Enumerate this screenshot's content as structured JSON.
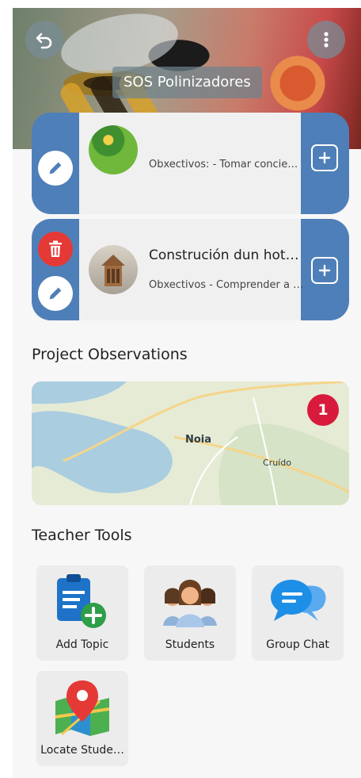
{
  "header": {
    "title": "SOS Polinizadores",
    "back_icon": "undo-icon",
    "menu_icon": "more-vertical-icon"
  },
  "topics": [
    {
      "title": "",
      "subtitle": "Obxectivos: - Tomar concie…",
      "thumbnail": "plants-image"
    },
    {
      "title": "Construción dun hot…",
      "subtitle": "Obxectivos - Comprender a …",
      "thumbnail": "insect-hotel-image"
    }
  ],
  "observations": {
    "heading": "Project Observations",
    "count": "1",
    "labels": {
      "town1": "Noia",
      "town2": "Cruído"
    }
  },
  "teacher_tools": {
    "heading": "Teacher Tools",
    "items": [
      {
        "label": "Add Topic",
        "icon": "add-topic-icon"
      },
      {
        "label": "Students",
        "icon": "students-icon"
      },
      {
        "label": "Group Chat",
        "icon": "group-chat-icon"
      },
      {
        "label": "Locate Stude…",
        "icon": "map-location-icon"
      }
    ]
  },
  "colors": {
    "card_blue": "#4f7fb8",
    "delete_red": "#e53935",
    "badge_red": "#d81b3c",
    "background": "#f7f7f7"
  }
}
